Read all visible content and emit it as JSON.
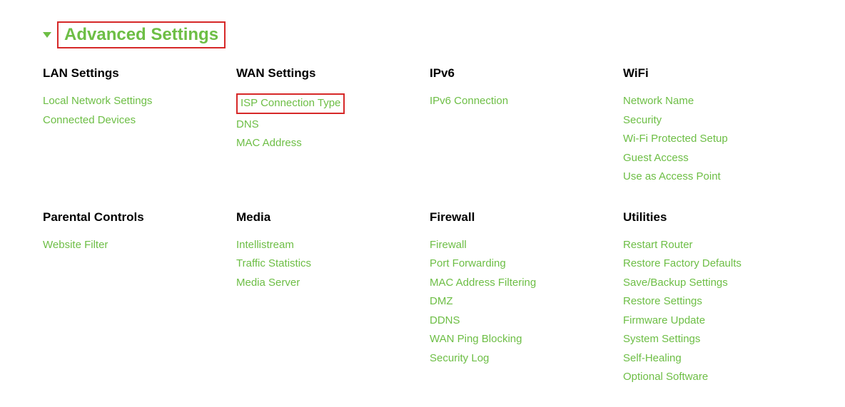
{
  "header": {
    "title": "Advanced Settings"
  },
  "columns": [
    {
      "heading": "LAN Settings",
      "links": [
        "Local Network Settings",
        "Connected Devices"
      ]
    },
    {
      "heading": "WAN Settings",
      "links": [
        "ISP Connection Type",
        "DNS",
        "MAC Address"
      ],
      "highlight": [
        0
      ]
    },
    {
      "heading": "IPv6",
      "links": [
        "IPv6 Connection"
      ]
    },
    {
      "heading": "WiFi",
      "links": [
        "Network Name",
        "Security",
        "Wi-Fi Protected Setup",
        "Guest Access",
        "Use as Access Point"
      ]
    },
    {
      "heading": "Parental Controls",
      "links": [
        "Website Filter"
      ]
    },
    {
      "heading": "Media",
      "links": [
        "Intellistream",
        "Traffic Statistics",
        "Media Server"
      ]
    },
    {
      "heading": "Firewall",
      "links": [
        "Firewall",
        "Port Forwarding",
        "MAC Address Filtering",
        "DMZ",
        "DDNS",
        "WAN Ping Blocking",
        "Security Log"
      ]
    },
    {
      "heading": "Utilities",
      "links": [
        "Restart Router",
        "Restore Factory Defaults",
        "Save/Backup Settings",
        "Restore Settings",
        "Firmware Update",
        "System Settings",
        "Self-Healing",
        "Optional Software"
      ]
    }
  ]
}
